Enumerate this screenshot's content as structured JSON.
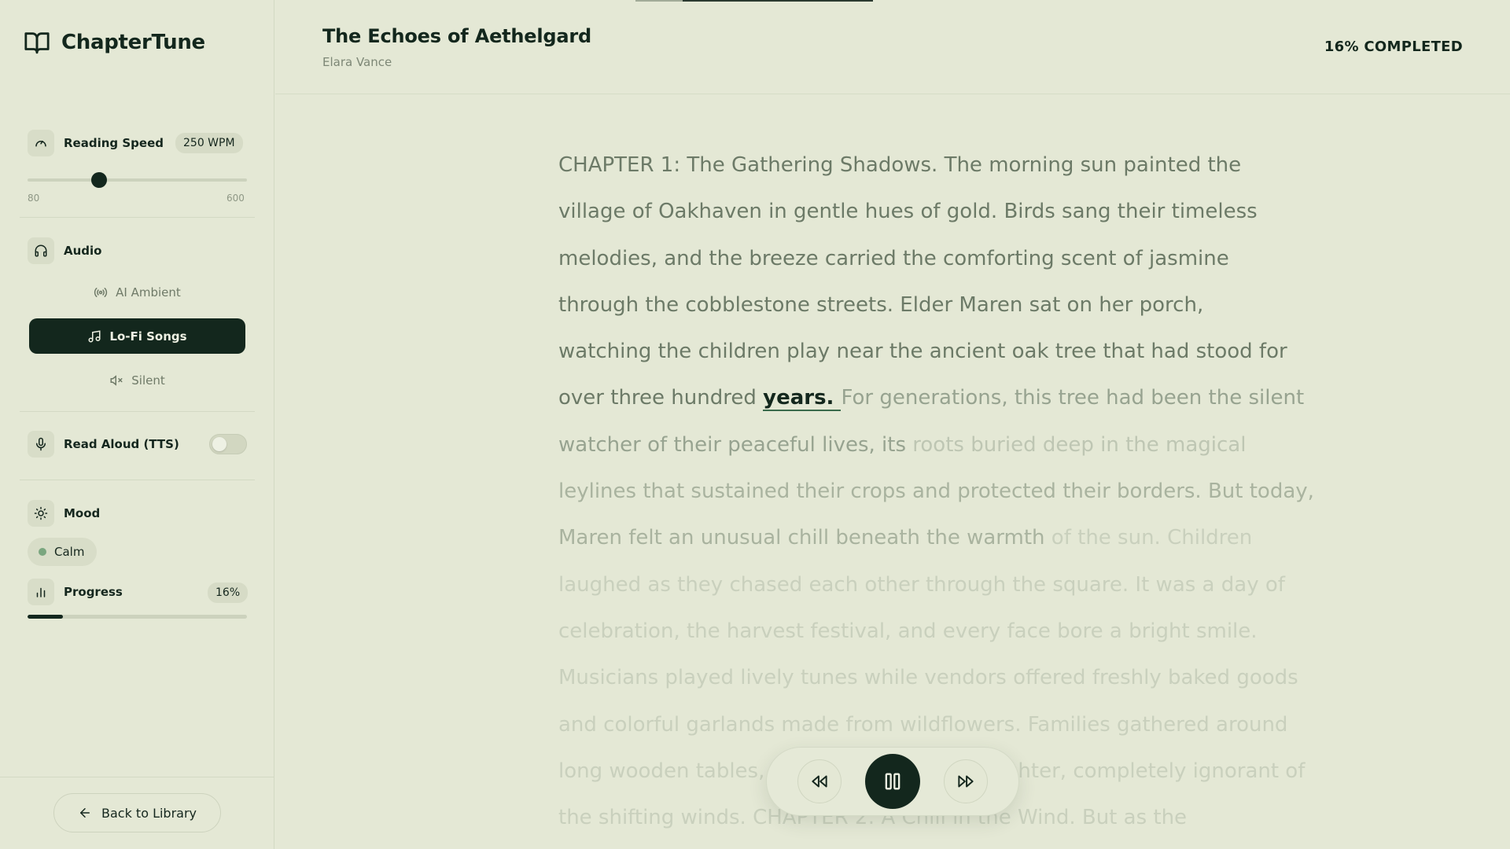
{
  "app": {
    "name": "ChapterTune"
  },
  "sidebar": {
    "reading_speed": {
      "label": "Reading Speed",
      "value_label": "250 WPM",
      "value": 250,
      "min": 80,
      "max": 600,
      "min_label": "80",
      "max_label": "600"
    },
    "audio": {
      "label": "Audio",
      "options": [
        {
          "label": "AI Ambient",
          "icon": "broadcast-icon",
          "active": false
        },
        {
          "label": "Lo-Fi Songs",
          "icon": "music-note-icon",
          "active": true
        },
        {
          "label": "Silent",
          "icon": "mute-icon",
          "active": false
        }
      ]
    },
    "tts": {
      "label": "Read Aloud (TTS)",
      "enabled": false
    },
    "mood": {
      "label": "Mood",
      "value": "Calm",
      "dot_color": "#7aa67f"
    },
    "progress": {
      "label": "Progress",
      "value_label": "16%",
      "fraction": 0.16
    },
    "back_label": "Back to Library"
  },
  "header": {
    "title": "The Echoes of Aethelgard",
    "author": "Elara Vance",
    "completed": "16% COMPLETED"
  },
  "reader": {
    "lines": [
      [
        {
          "t": "CHAPTER 1: The Gathering Shadows. The morning sun painted the",
          "s": "read"
        }
      ],
      [
        {
          "t": "village of Oakhaven in gentle hues of gold. Birds sang their timeless",
          "s": "read"
        }
      ],
      [
        {
          "t": "melodies, and the breeze carried the comforting scent of jasmine",
          "s": "read"
        }
      ],
      [
        {
          "t": "through the cobblestone streets. Elder Maren sat on her porch,",
          "s": "read"
        }
      ],
      [
        {
          "t": "watching the children play near the ancient oak tree that had stood for",
          "s": "read"
        }
      ],
      [
        {
          "t": "over three hundred ",
          "s": "read"
        },
        {
          "t": "years. ",
          "s": "current"
        },
        {
          "t": "For generations, this tree had been the silent",
          "s": "near"
        }
      ],
      [
        {
          "t": "watcher of their peaceful lives, its ",
          "s": "near"
        },
        {
          "t": "roots buried deep in the magical",
          "s": "far"
        }
      ],
      [
        {
          "t": "leylines that sustained their crops and protected their borders. But today,",
          "s": "mid"
        }
      ],
      [
        {
          "t": "Maren felt an unusual chill beneath the warmth ",
          "s": "mid"
        },
        {
          "t": "of the sun. Children",
          "s": "farther"
        }
      ],
      [
        {
          "t": "laughed as they chased each other through the square. It was a day of",
          "s": "farther"
        }
      ],
      [
        {
          "t": "celebration, the harvest festival, and every face bore a bright smile.",
          "s": "farther"
        }
      ],
      [
        {
          "t": "Musicians played lively tunes while vendors offered freshly baked goods",
          "s": "farther"
        }
      ],
      [
        {
          "t": "and colorful garlands made from wildflowers. Families gathered around",
          "s": "farther"
        }
      ],
      [
        {
          "t": "long wooden tables, sharing stories and laughter, completely ignorant of",
          "s": "farther"
        }
      ],
      [
        {
          "t": "the shifting winds. CHAPTER 2: A Chill in the Wind. But as the",
          "s": "farther"
        }
      ]
    ]
  },
  "player": {
    "rewind": "rewind-icon",
    "pause": "pause-icon",
    "forward": "fast-forward-icon"
  }
}
